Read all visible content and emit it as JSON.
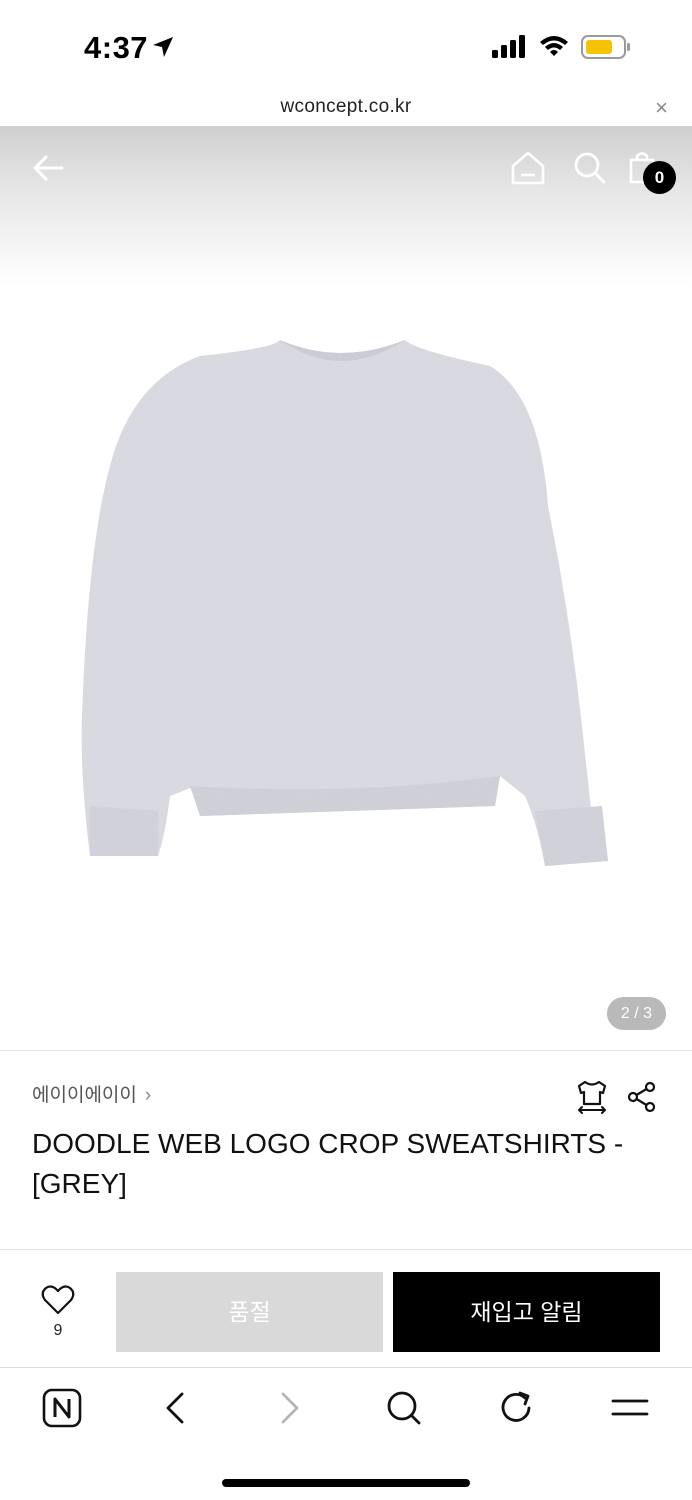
{
  "status_bar": {
    "time": "4:37"
  },
  "url_bar": {
    "domain": "wconcept.co.kr",
    "close": "×"
  },
  "header": {
    "cart_count": "0"
  },
  "gallery": {
    "current": "2",
    "total": "3",
    "indicator": "2 / 3"
  },
  "product": {
    "brand": "에이이에이이",
    "brand_chevron": "›",
    "title": "DOODLE WEB LOGO CROP SWEATSHIRTS - [GREY]"
  },
  "actions": {
    "like_count": "9",
    "soldout_label": "품절",
    "restock_label": "재입고 알림"
  },
  "colors": {
    "accent_black": "#000000",
    "soldout_grey": "#d9d9d9",
    "battery_yellow": "#f5c400",
    "sweatshirt_grey": "#d7d7df"
  },
  "icons": [
    "location-arrow-icon",
    "signal-icon",
    "wifi-icon",
    "battery-icon",
    "close-icon",
    "back-arrow-icon",
    "home-icon",
    "search-icon",
    "cart-icon",
    "size-guide-icon",
    "share-icon",
    "heart-icon",
    "naver-n-icon",
    "browser-back-icon",
    "browser-forward-icon",
    "browser-search-icon",
    "refresh-icon",
    "menu-icon"
  ]
}
